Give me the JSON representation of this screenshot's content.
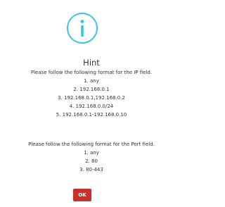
{
  "dialog": {
    "icon": "info-icon",
    "accent_color": "#3cc3e0",
    "title": "Hint",
    "ip_intro": "Please follow the following format for the IP field.",
    "ip_items": [
      "1. any",
      "2. 192.168.0.1",
      "3. 192.168.0.1,192.168.0.2",
      "4. 192.168.0.0/24",
      "5. 192.168.0.1-192.168.0.10"
    ],
    "port_intro": "Please follow the following format for the Port field.",
    "port_items": [
      "1. any",
      "2. 80",
      "3. 80-443"
    ],
    "ok_label": "OK",
    "ok_color": "#c9302c"
  }
}
